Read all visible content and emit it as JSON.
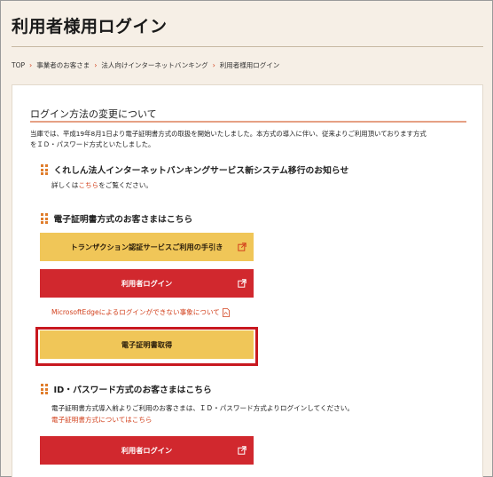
{
  "page": {
    "title": "利用者様用ログイン"
  },
  "breadcrumb": [
    {
      "label": "TOP"
    },
    {
      "label": "事業者のお客さま"
    },
    {
      "label": "法人向けインターネットバンキング"
    },
    {
      "label": "利用者様用ログイン"
    }
  ],
  "section": {
    "title": "ログイン方法の変更について",
    "notice_line1": "当庫では、平成19年8月1日より電子証明書方式の取扱を開始いたしました。本方式の導入に伴い、従来よりご利用頂いております方式",
    "notice_line2": "をＩＤ・パスワード方式といたしました。"
  },
  "news": {
    "heading": "くれしん法人インターネットバンキングサービス新システム移行のお知らせ",
    "text_before": "詳しくは",
    "link": "こちら",
    "text_after": "をご覧ください。"
  },
  "cert_section": {
    "heading": "電子証明書方式のお客さまはこちら",
    "transaction_button": "トランザクション認証サービスご利用の手引き",
    "login_button": "利用者ログイン",
    "edge_link": "MicrosoftEdgeによるログインができない事象について",
    "cert_button": "電子証明書取得"
  },
  "id_section": {
    "heading": "ID・パスワード方式のお客さまはこちら",
    "text": "電子証明書方式導入前よりご利用のお客さまは、ＩＤ・パスワード方式よりログインしてください。",
    "link": "電子証明書方式についてはこちら",
    "login_button": "利用者ログイン"
  },
  "colors": {
    "accent": "#d2401c",
    "button_red": "#d1282e",
    "button_yellow": "#f0c658",
    "highlight": "#c8181f",
    "background": "#f6efe6"
  },
  "icons": {
    "external": "external-link-icon",
    "pdf": "pdf-icon",
    "bullet": "square-dots-icon"
  }
}
